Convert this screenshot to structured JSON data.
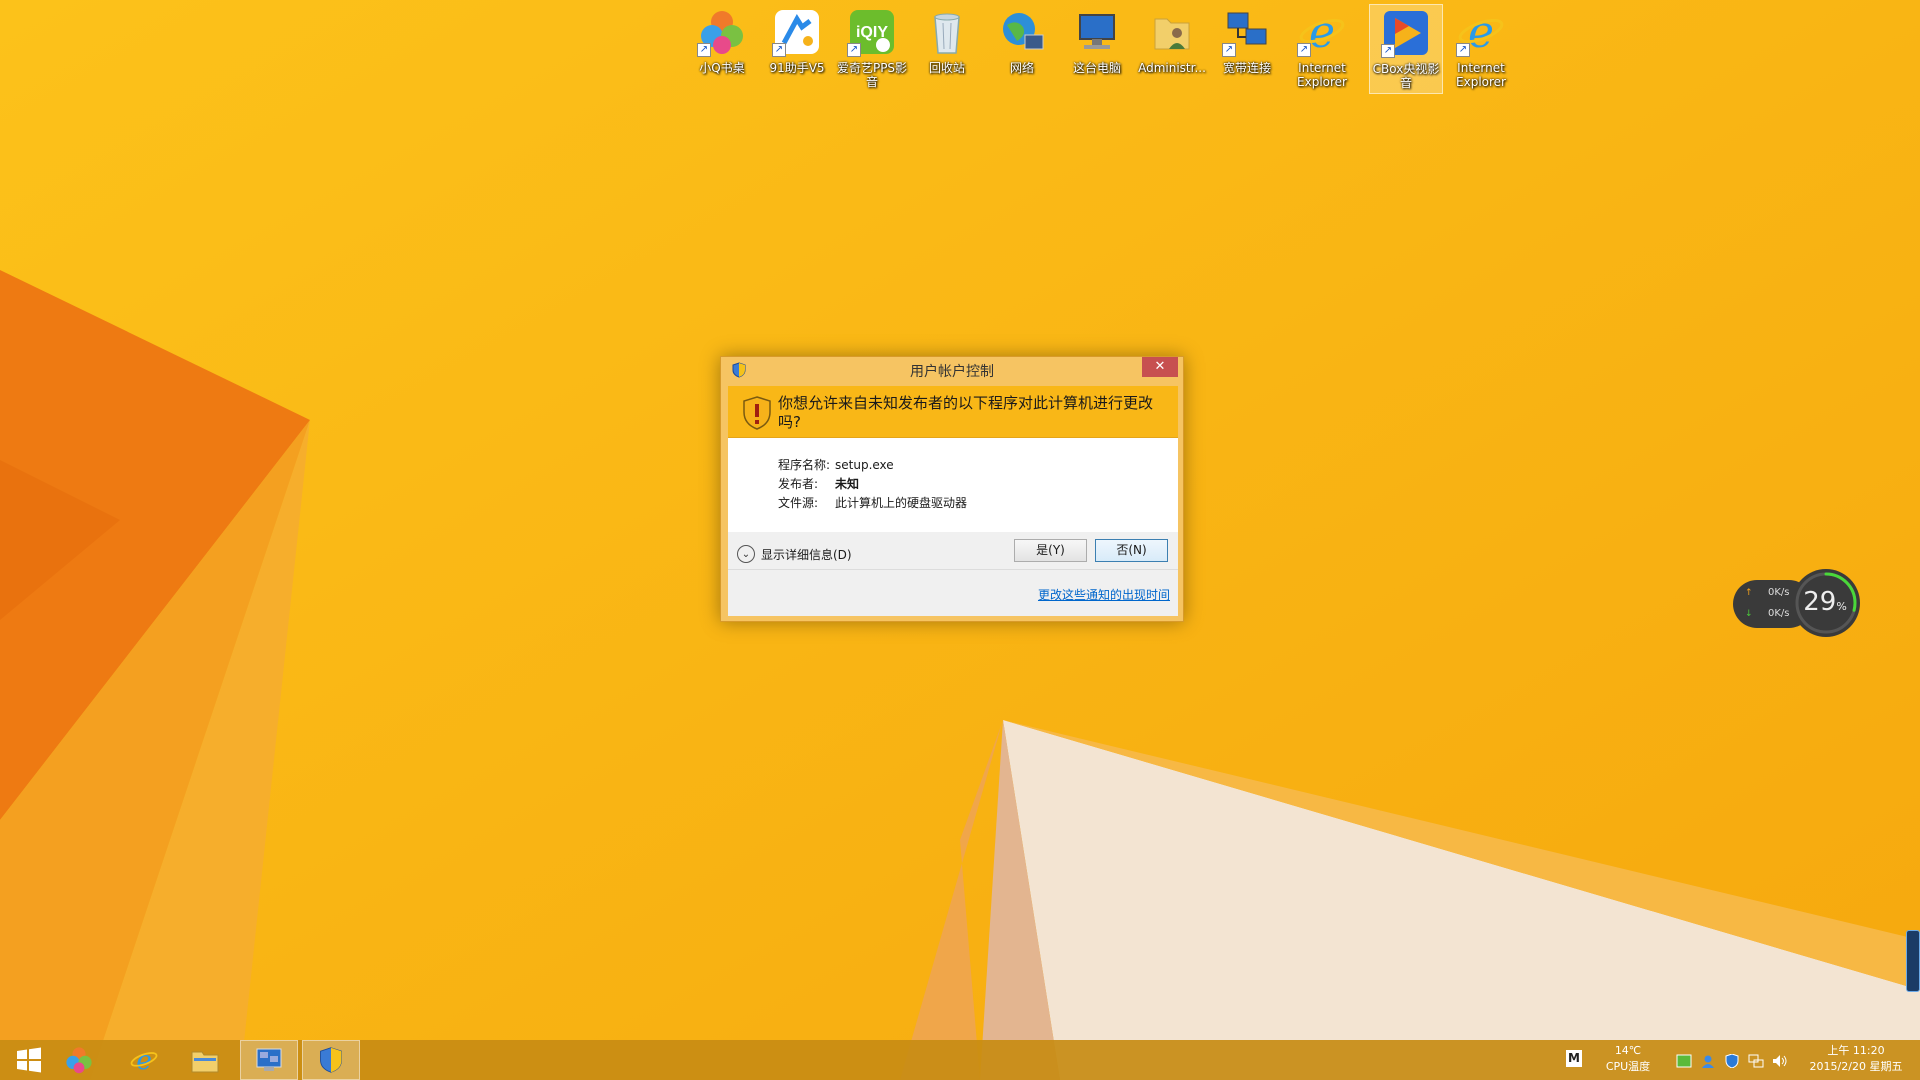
{
  "desktop": {
    "icons": [
      {
        "label": "小Q书桌",
        "icon": "xiaoq-desk-icon"
      },
      {
        "label": "91助手V5",
        "icon": "91-assistant-icon"
      },
      {
        "label": "爱奇艺PPS影音",
        "icon": "iqiyi-pps-icon"
      },
      {
        "label": "回收站",
        "icon": "recycle-bin-icon"
      },
      {
        "label": "网络",
        "icon": "network-globe-icon"
      },
      {
        "label": "这台电脑",
        "icon": "this-pc-icon"
      },
      {
        "label": "Administr...",
        "icon": "user-folder-icon"
      },
      {
        "label": "宽带连接",
        "icon": "broadband-connection-icon"
      },
      {
        "label": "Internet Explorer",
        "icon": "internet-explorer-icon"
      },
      {
        "label": "CBox央视影音",
        "icon": "cbox-player-icon"
      },
      {
        "label": "Internet Explorer",
        "icon": "internet-explorer-icon"
      }
    ]
  },
  "uac": {
    "title": "用户帐户控制",
    "close": "✕",
    "question": "你想允许来自未知发布者的以下程序对此计算机进行更改吗?",
    "fields": [
      {
        "key": "程序名称:",
        "value": "setup.exe"
      },
      {
        "key": "发布者:",
        "value": "未知"
      },
      {
        "key": "文件源:",
        "value": "此计算机上的硬盘驱动器"
      }
    ],
    "details_label": "显示详细信息(D)",
    "yes_label": "是(Y)",
    "no_label": "否(N)",
    "link": "更改这些通知的出现时间"
  },
  "net_widget": {
    "upload": "0K/s",
    "download": "0K/s",
    "percent": "29",
    "percent_unit": "%",
    "usage_fraction": 0.29
  },
  "taskbar": {
    "apps": [
      "start-windows-icon",
      "xiaoq-desk-icon",
      "internet-explorer-icon",
      "file-explorer-icon",
      "network-connections-icon",
      "uac-shield-icon"
    ],
    "ime": "M",
    "temp": "14℃",
    "temp_label": "CPU温度",
    "time": "上午 11:20",
    "date": "2015/2/20 星期五"
  },
  "colors": {
    "wallpaper": "#f9b40c",
    "uac_header": "#f9b717",
    "close_red": "#c75050",
    "link_blue": "#0066cc"
  }
}
